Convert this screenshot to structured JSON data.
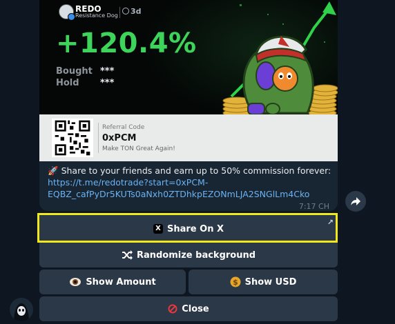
{
  "card": {
    "brand_name": "REDO",
    "brand_sub": "Resistance Dog",
    "duration": "3d",
    "pnl": "+120.4%",
    "stats": [
      {
        "label": "Bought",
        "value": "***"
      },
      {
        "label": "Hold",
        "value": "***"
      }
    ],
    "referral_label": "Referral Code",
    "referral_code": "0xPCM",
    "tagline": "Make TON Great Again!"
  },
  "message": {
    "text": "Share to your friends and earn up to 50% commission forever:",
    "link_line1": "https://t.me/redotrade?start=0xPCM-",
    "link_line2": "EQBZ_cafPyDr5KUTs0aNxh0ZTDhkpEZONmLJA2SNGlLm4Cko",
    "time": "7:17 CH"
  },
  "buttons": {
    "share_x": "Share On X",
    "randomize": "Randomize background",
    "show_amount": "Show Amount",
    "show_usd": "Show USD",
    "close": "Close"
  },
  "colors": {
    "background": "#0e1621",
    "bubble": "#182533",
    "button": "#2b3847",
    "pnl_green": "#3ed35a",
    "link": "#6ab3f3",
    "highlight": "#f2e81a"
  },
  "icons": {
    "share_x": "x-logo-icon",
    "randomize": "shuffle-icon",
    "show_amount": "eye-icon",
    "show_usd": "dollar-coin-icon",
    "close": "prohibited-icon",
    "forward": "forward-arrow-icon",
    "external": "external-link-icon"
  }
}
